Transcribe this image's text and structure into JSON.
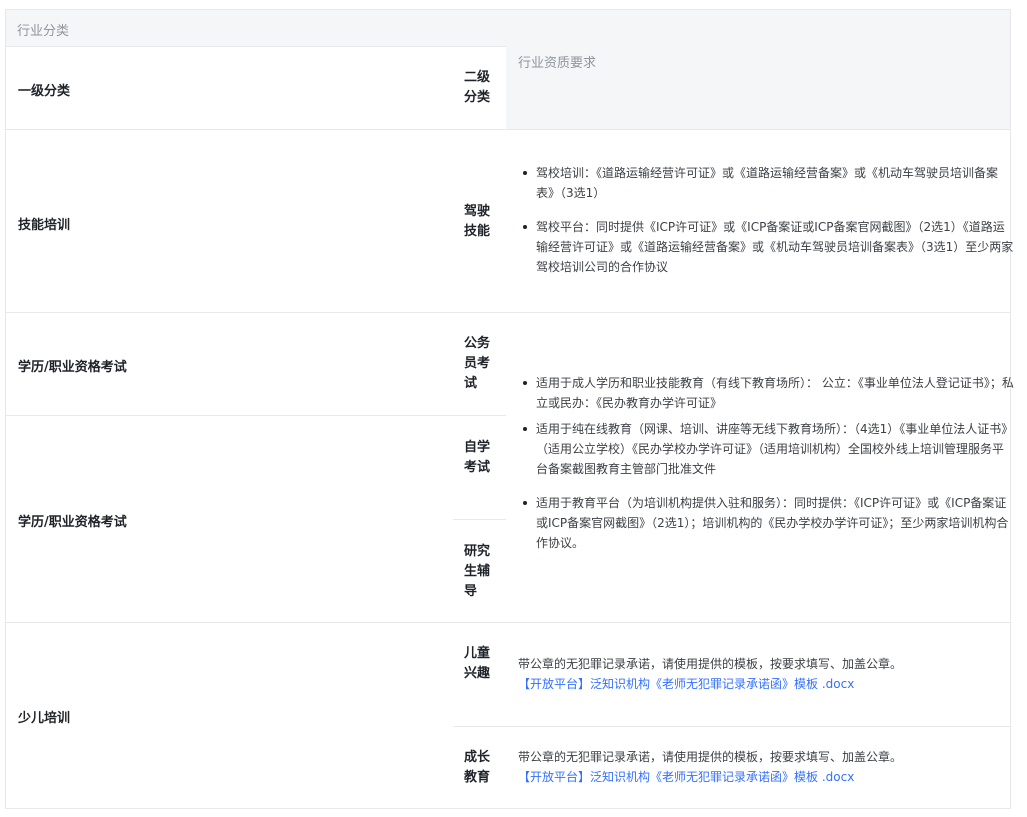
{
  "header": {
    "industry_label": "行业分类",
    "level1_label": "一级分类",
    "level2_label": "二级分类",
    "requirement_label": "行业资质要求"
  },
  "rows": {
    "skill": {
      "level1": "技能培训",
      "level2": "驾驶技能",
      "items": [
        "驾校培训：《道路运输经营许可证》或《道路运输经营备案》或《机动车驾驶员培训备案表》（3选1）",
        "驾校平台：同时提供《ICP许可证》或《ICP备案证或ICP备案官网截图》（2选1）《道路运输经营许可证》或《道路运输经营备案》或《机动车驾驶员培训备案表》（3选1）至少两家驾校培训公司的合作协议"
      ]
    },
    "exam1": {
      "level1": "学历/职业资格考试",
      "level2": "公务员考试"
    },
    "exam2": {
      "level1": "学历/职业资格考试",
      "level2_a": "自学考试",
      "level2_b": "研究生辅导"
    },
    "exam_items": [
      "适用于成人学历和职业技能教育（有线下教育场所）： 公立：《事业单位法人登记证书》；私立或民办：《民办教育办学许可证》",
      "适用于纯在线教育（网课、培训、讲座等无线下教育场所）：（4选1）《事业单位法人证书》（适用公立学校）《民办学校办学许可证》（适用培训机构）全国校外线上培训管理服务平台备案截图教育主管部门批准文件",
      "适用于教育平台（为培训机构提供入驻和服务）：同时提供：《ICP许可证》或《ICP备案证或ICP备案官网截图》（2选1）；培训机构的《民办学校办学许可证》；至少两家培训机构合作协议。"
    ],
    "kids": {
      "level1": "少儿培训",
      "sub1": {
        "level2": "儿童兴趣",
        "text": "带公章的无犯罪记录承诺，请使用提供的模板，按要求填写、加盖公章。",
        "link": "【开放平台】泛知识机构《老师无犯罪记录承诺函》模板 .docx"
      },
      "sub2": {
        "level2": "成长教育",
        "text": "带公章的无犯罪记录承诺，请使用提供的模板，按要求填写、加盖公章。",
        "link": "【开放平台】泛知识机构《老师无犯罪记录承诺函》模板 .docx"
      }
    }
  }
}
